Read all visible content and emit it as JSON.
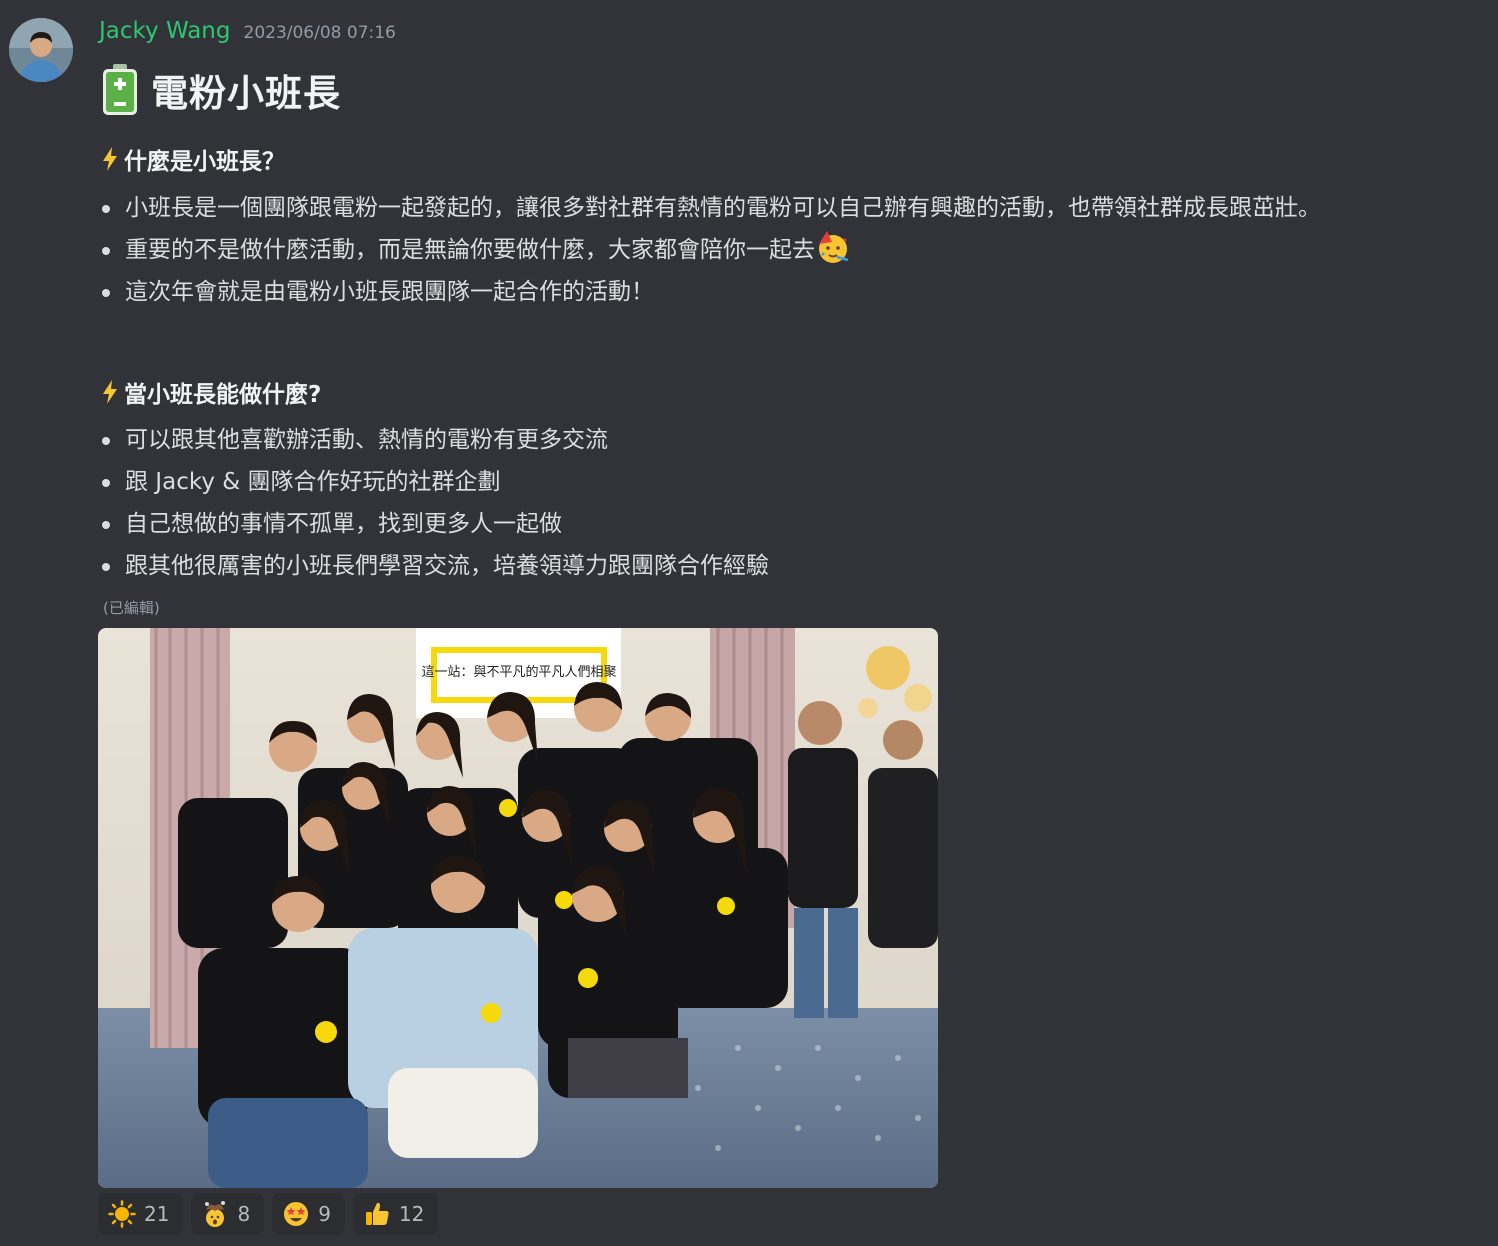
{
  "author": {
    "name": "Jacky Wang",
    "timestamp": "2023/06/08 07:16",
    "avatar": "avatar-photo"
  },
  "post": {
    "title_icon": "battery-icon",
    "title": "電粉小班長",
    "sections": [
      {
        "icon": "lightning-bolt-icon",
        "heading": "什麼是小班長？",
        "bullets": [
          "小班長是一個團隊跟電粉一起發起的，讓很多對社群有熱情的電粉可以自己辦有興趣的活動，也帶領社群成長跟茁壯。",
          "重要的不是做什麼活動，而是無論你要做什麼，大家都會陪你一起去",
          "這次年會就是由電粉小班長跟團隊一起合作的活動！"
        ],
        "bullet2_icon": "partying-face-icon"
      },
      {
        "icon": "lightning-bolt-icon",
        "heading": "當小班長能做什麼?",
        "bullets": [
          "可以跟其他喜歡辦活動、熱情的電粉有更多交流",
          "跟 Jacky & 團隊合作好玩的社群企劃",
          "自己想做的事情不孤單，找到更多人一起做",
          "跟其他很厲害的小班長們學習交流，培養領導力跟團隊合作經驗"
        ]
      }
    ],
    "edited_label": "(已編輯)",
    "attachment": {
      "type": "photo",
      "description": "group-photo",
      "sign_text": "這一站：與不平凡的平凡人們相聚"
    }
  },
  "reactions": [
    {
      "emoji": "sun-icon",
      "count": "21"
    },
    {
      "emoji": "mind-blown-icon",
      "count": "8"
    },
    {
      "emoji": "star-struck-icon",
      "count": "9"
    },
    {
      "emoji": "thumbs-up-icon",
      "count": "12"
    }
  ],
  "colors": {
    "background": "#313338",
    "username": "#2dc770",
    "text": "#dbdee1",
    "muted": "#949ba4",
    "reaction_bg": "#2b2d31",
    "accent_yellow": "#f5d90a"
  }
}
